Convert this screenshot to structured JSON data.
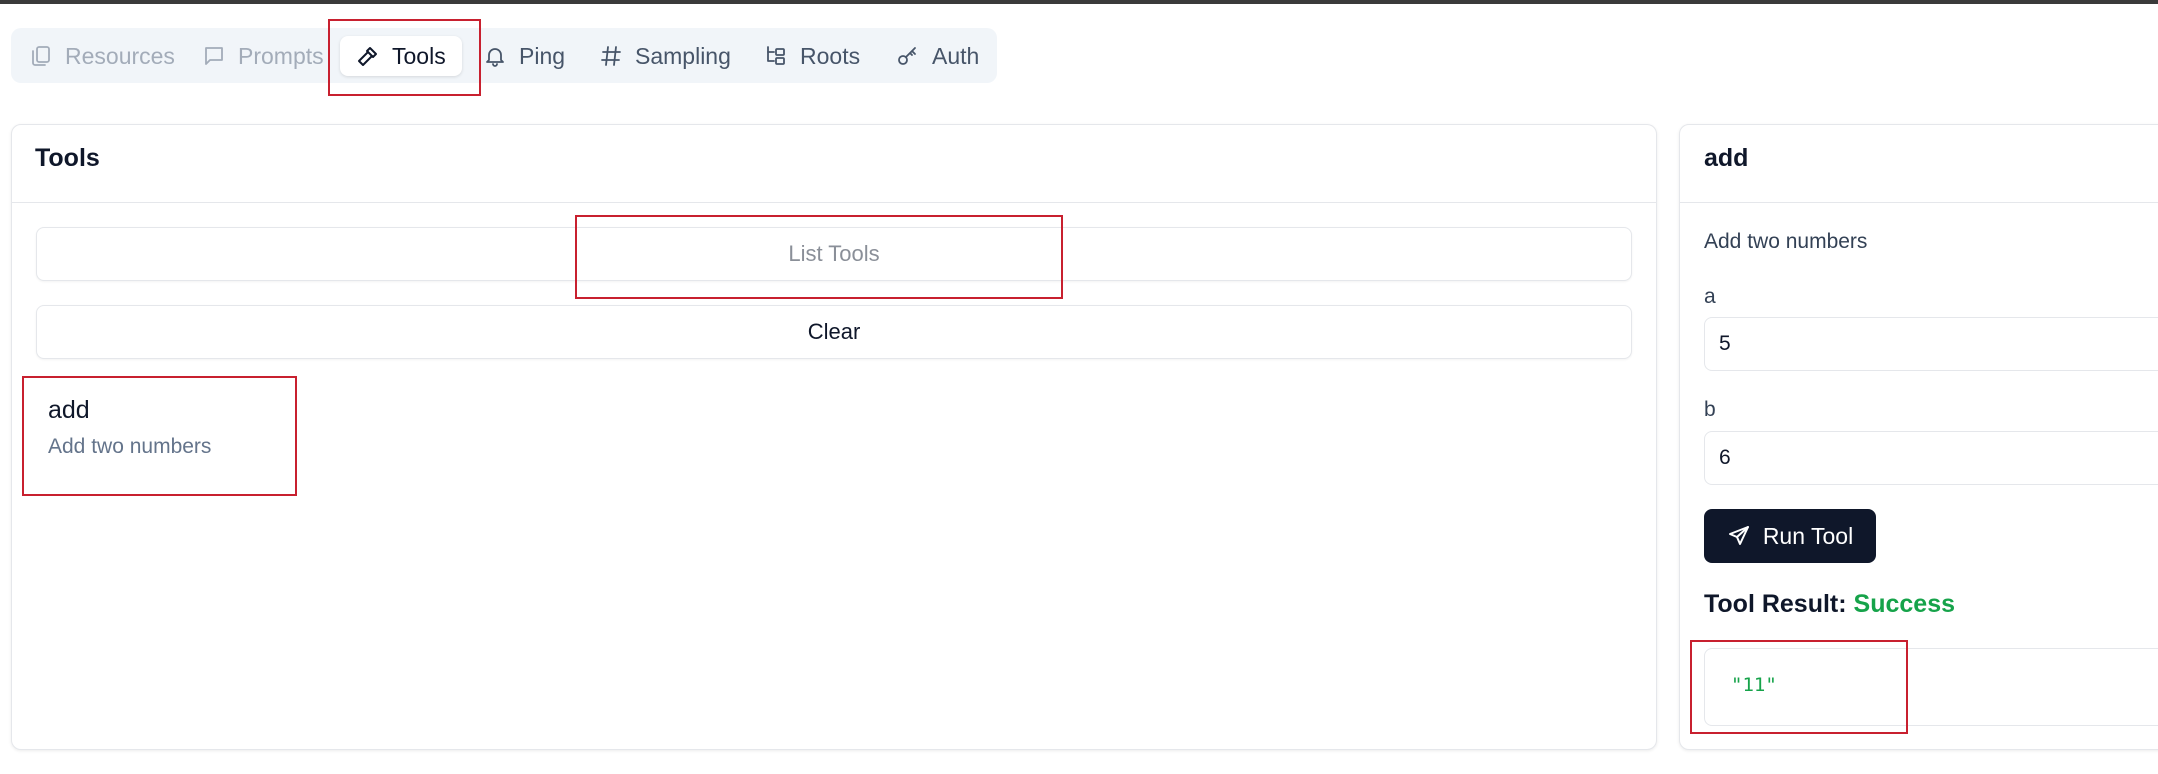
{
  "tabs": [
    {
      "label": "Resources",
      "icon": "files-icon",
      "state": "disabled"
    },
    {
      "label": "Prompts",
      "icon": "message-square-icon",
      "state": "disabled"
    },
    {
      "label": "Tools",
      "icon": "hammer-icon",
      "state": "active"
    },
    {
      "label": "Ping",
      "icon": "bell-icon",
      "state": "normal"
    },
    {
      "label": "Sampling",
      "icon": "hash-icon",
      "state": "normal"
    },
    {
      "label": "Roots",
      "icon": "folder-tree-icon",
      "state": "normal"
    },
    {
      "label": "Auth",
      "icon": "key-icon",
      "state": "normal"
    }
  ],
  "tools_panel": {
    "title": "Tools",
    "list_button": "List Tools",
    "clear_button": "Clear",
    "items": [
      {
        "name": "add",
        "description": "Add two numbers"
      }
    ]
  },
  "detail_panel": {
    "title": "add",
    "description": "Add two numbers",
    "params": [
      {
        "label": "a",
        "value": "5"
      },
      {
        "label": "b",
        "value": "6"
      }
    ],
    "run_button": "Run Tool",
    "result_label": "Tool Result:",
    "result_status": "Success",
    "result_value": "\"11\""
  },
  "colors": {
    "primary": "#0f172a",
    "success": "#16a34a",
    "highlight": "#c8202f"
  }
}
